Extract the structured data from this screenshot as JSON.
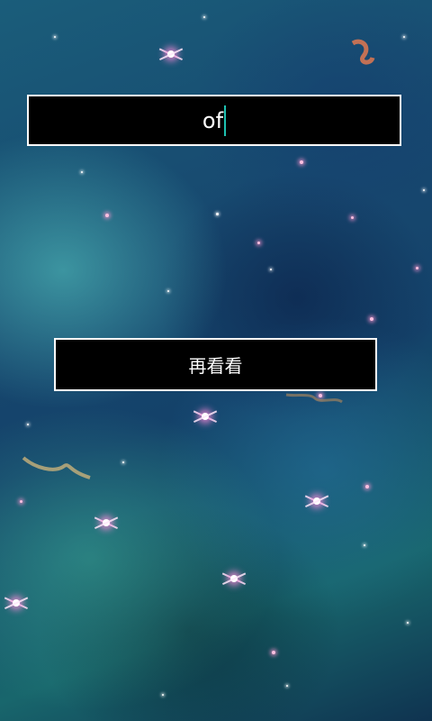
{
  "search": {
    "value": "of"
  },
  "action": {
    "label": "再看看"
  }
}
